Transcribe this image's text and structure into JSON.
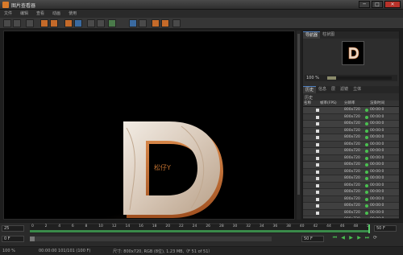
{
  "window": {
    "title": "图片查看器",
    "minimize": "─",
    "maximize": "□",
    "close": "✕"
  },
  "menu": [
    "文件",
    "编辑",
    "查看",
    "动画",
    "使用"
  ],
  "toolbar": {
    "icons": [
      "open-icon",
      "save-icon",
      "copy-icon",
      "render-icon",
      "crop-icon",
      "camera-icon",
      "print-icon",
      "channel-icon",
      "view-icon",
      "zoom-icon",
      "fit-icon",
      "region-icon",
      "settings-icon"
    ]
  },
  "viewport": {
    "letter": "D",
    "watermark": "松仔Y"
  },
  "panel": {
    "tabs": [
      "导航器",
      "柱状图"
    ],
    "zoom": "100 %",
    "zoom_level": 0.14,
    "history_tabs": [
      "历史",
      "信息",
      "层",
      "滤镜",
      "立体"
    ],
    "history_label": "历史",
    "columns": [
      "名称",
      "",
      "帧率(FPS)",
      "分辨率",
      "",
      "渲染时间"
    ],
    "rows": [
      {
        "res": "800x720",
        "time": "00:00:0"
      },
      {
        "res": "800x720",
        "time": "00:00:0"
      },
      {
        "res": "800x720",
        "time": "00:00:0"
      },
      {
        "res": "800x720",
        "time": "00:00:0"
      },
      {
        "res": "800x720",
        "time": "00:00:0"
      },
      {
        "res": "800x720",
        "time": "00:00:0"
      },
      {
        "res": "800x720",
        "time": "00:00:0"
      },
      {
        "res": "800x720",
        "time": "00:00:0"
      },
      {
        "res": "800x720",
        "time": "00:00:0"
      },
      {
        "res": "800x720",
        "time": "00:00:0"
      },
      {
        "res": "800x720",
        "time": "00:00:0"
      },
      {
        "res": "800x720",
        "time": "00:00:0"
      },
      {
        "res": "800x720",
        "time": "00:00:0"
      },
      {
        "res": "800x720",
        "time": "00:00:0"
      },
      {
        "res": "800x720",
        "time": "00:00:0"
      },
      {
        "res": "800x720",
        "time": "00:00:0"
      },
      {
        "res": "800x720",
        "time": "00:00:0"
      }
    ]
  },
  "timeline": {
    "current_frame": "25",
    "end_frame": "50 F",
    "start": "0 F",
    "range_end": "50 F",
    "ticks": [
      "0",
      "2",
      "4",
      "6",
      "8",
      "10",
      "12",
      "14",
      "16",
      "18",
      "20",
      "22",
      "24",
      "26",
      "28",
      "30",
      "32",
      "34",
      "36",
      "38",
      "40",
      "42",
      "44",
      "46",
      "48",
      "5"
    ]
  },
  "status": {
    "zoom": "100 %",
    "time": "00:00:00 101/101 (100 F)",
    "info": "尺寸: 800x720, RGB (8位), 1.23 MB,（F 51 of 51）"
  }
}
